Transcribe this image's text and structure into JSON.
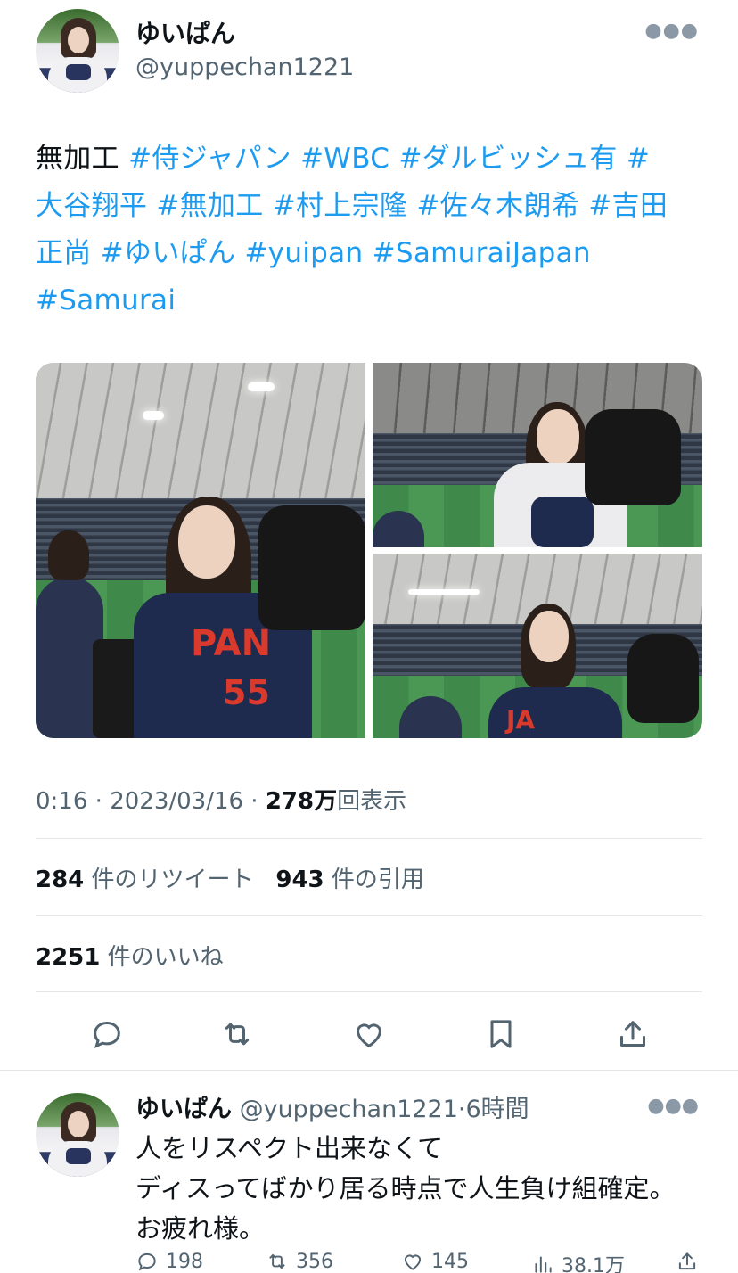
{
  "tweet": {
    "user_name": "ゆいぱん",
    "user_handle": "@yuppechan1221",
    "more_icon": "more-horizontal-icon",
    "text_lines": [
      [
        {
          "t": "無加工 ",
          "tag": false
        },
        {
          "t": "#侍ジャパン",
          "tag": true
        },
        {
          "t": " ",
          "tag": false
        },
        {
          "t": "#WBC",
          "tag": true
        },
        {
          "t": " ",
          "tag": false
        },
        {
          "t": "#ダルビッシュ有",
          "tag": true
        },
        {
          "t": " #",
          "tag": true
        }
      ],
      [
        {
          "t": "大谷翔平",
          "tag": true
        },
        {
          "t": " ",
          "tag": false
        },
        {
          "t": "#無加工",
          "tag": true
        },
        {
          "t": " ",
          "tag": false
        },
        {
          "t": "#村上宗隆",
          "tag": true
        },
        {
          "t": " ",
          "tag": false
        },
        {
          "t": "#佐々木朗希",
          "tag": true
        },
        {
          "t": " ",
          "tag": false
        },
        {
          "t": "#吉田",
          "tag": true
        }
      ],
      [
        {
          "t": "正尚",
          "tag": true
        },
        {
          "t": " ",
          "tag": false
        },
        {
          "t": "#ゆいぱん",
          "tag": true
        },
        {
          "t": " ",
          "tag": false
        },
        {
          "t": "#yuipan",
          "tag": true
        },
        {
          "t": " ",
          "tag": false
        },
        {
          "t": "#SamuraiJapan",
          "tag": true
        }
      ],
      [
        {
          "t": "#Samurai",
          "tag": true
        }
      ]
    ],
    "media": [
      "photo-woman-in-japan-jersey-with-glove",
      "photo-woman-with-glove-stadium",
      "photo-woman-with-glove-stadium-wide"
    ],
    "jersey_text": "PAN",
    "jersey_number": "55",
    "jersey_partial": "JA",
    "time": "0:16",
    "sep1": " · ",
    "date": "2023/03/16",
    "sep2": " · ",
    "views_count": "278万",
    "views_label": "回表示",
    "retweets_count": "284",
    "retweets_label": "件のリツイート",
    "quotes_count": "943",
    "quotes_label": "件の引用",
    "likes_count": "2251",
    "likes_label": "件のいいね",
    "actions": [
      "reply-icon",
      "retweet-icon",
      "like-icon",
      "bookmark-icon",
      "share-icon"
    ]
  },
  "reply": {
    "user_name": "ゆいぱん",
    "user_handle": "@yuppechan1221",
    "dot": "·",
    "time": "6時間",
    "more_icon": "more-horizontal-icon",
    "lines": [
      "人をリスペクト出来なくて",
      "ディスってばかり居る時点で人生負け組確定。",
      "お疲れ様。"
    ],
    "replies": "198",
    "retweets": "356",
    "likes": "145",
    "views": "38.1万"
  },
  "colors": {
    "accent": "#1d9bf0",
    "text": "#0f1419",
    "secondary": "#536471",
    "divider": "#e4e7ea"
  }
}
